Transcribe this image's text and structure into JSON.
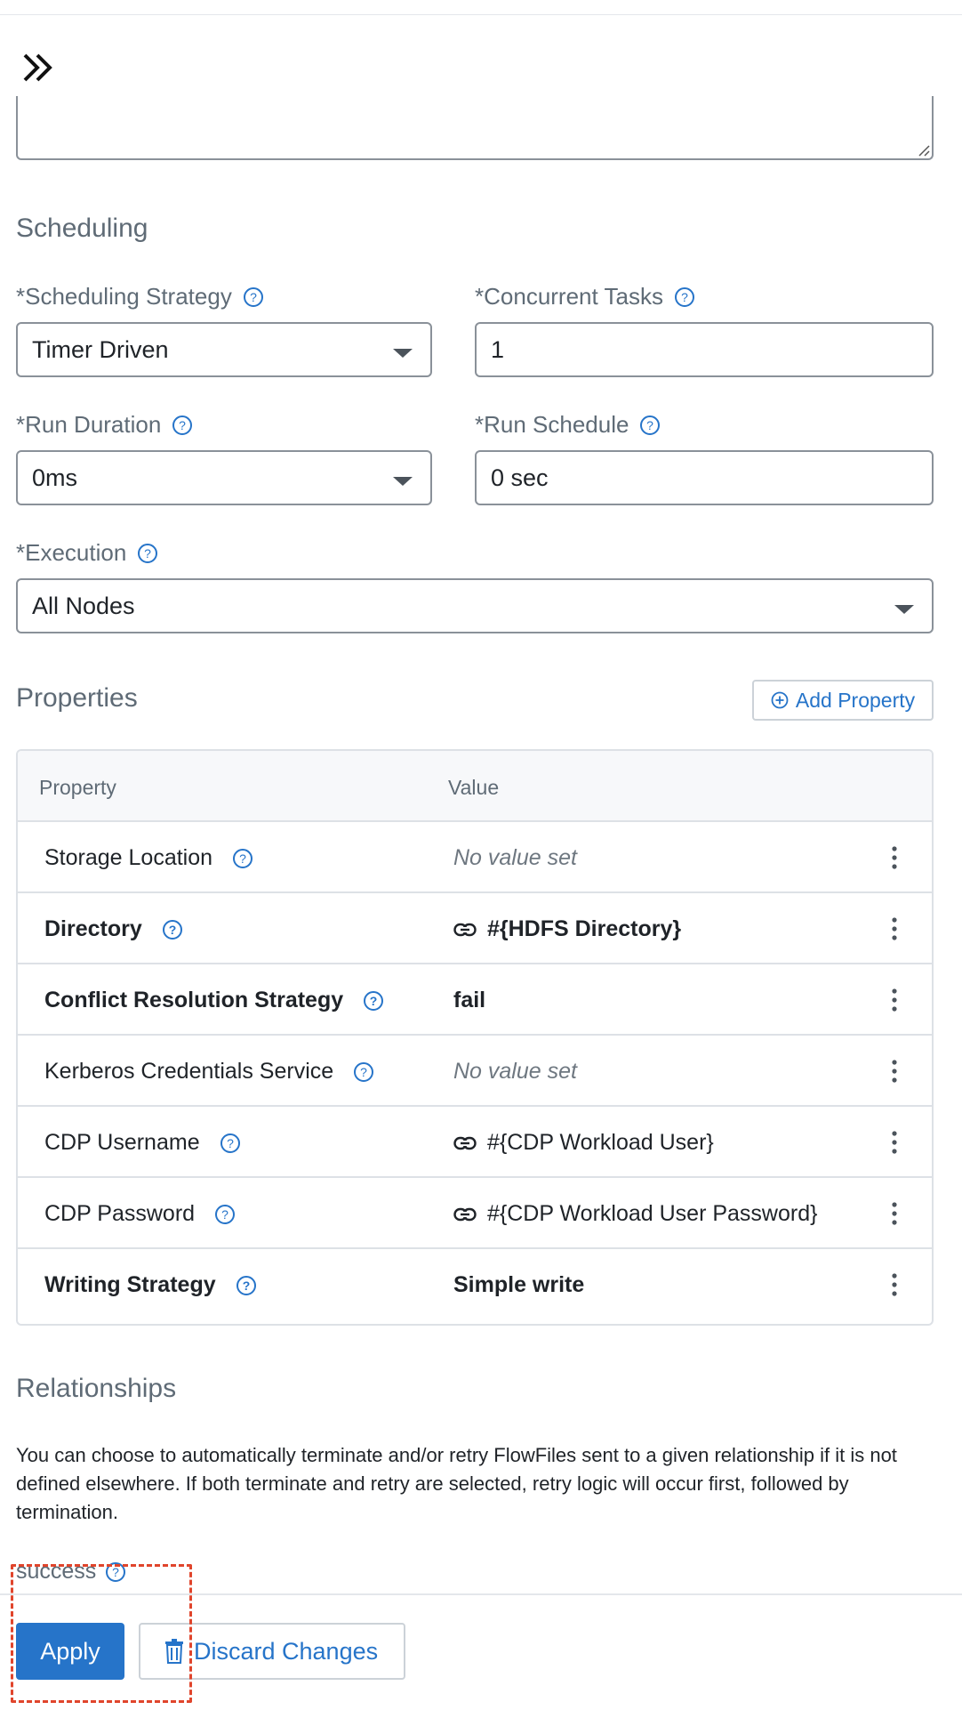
{
  "icons": {
    "expand": "double-chevron-right-icon",
    "help": "question-circle-icon",
    "add": "plus-circle-icon",
    "link": "link-icon",
    "more": "vertical-dots-icon",
    "trash": "trash-icon"
  },
  "colors": {
    "accent": "#2674c9",
    "annotation": "#e0452c",
    "muted_text": "#5f6b76"
  },
  "scheduling": {
    "section_title": "Scheduling",
    "strategy": {
      "label": "*Scheduling Strategy",
      "value": "Timer Driven"
    },
    "concurrent_tasks": {
      "label": "*Concurrent Tasks",
      "value": "1"
    },
    "run_duration": {
      "label": "*Run Duration",
      "value": "0ms"
    },
    "run_schedule": {
      "label": "*Run Schedule",
      "value": "0 sec"
    },
    "execution": {
      "label": "*Execution",
      "value": "All Nodes"
    }
  },
  "properties": {
    "section_title": "Properties",
    "add_button_label": "Add Property",
    "columns": [
      "Property",
      "Value"
    ],
    "rows": [
      {
        "name": "Storage Location",
        "value": "No value set",
        "required": false,
        "is_parameter": false,
        "empty": true
      },
      {
        "name": "Directory",
        "value": "#{HDFS Directory}",
        "required": true,
        "is_parameter": true,
        "empty": false
      },
      {
        "name": "Conflict Resolution Strategy",
        "value": "fail",
        "required": true,
        "is_parameter": false,
        "empty": false
      },
      {
        "name": "Kerberos Credentials Service",
        "value": "No value set",
        "required": false,
        "is_parameter": false,
        "empty": true
      },
      {
        "name": "CDP Username",
        "value": "#{CDP Workload User}",
        "required": false,
        "is_parameter": true,
        "empty": false
      },
      {
        "name": "CDP Password",
        "value": "#{CDP Workload User Password}",
        "required": false,
        "is_parameter": true,
        "empty": false
      },
      {
        "name": "Writing Strategy",
        "value": "Simple write",
        "required": true,
        "is_parameter": false,
        "empty": false
      }
    ]
  },
  "relationships": {
    "section_title": "Relationships",
    "description": "You can choose to automatically terminate and/or retry FlowFiles sent to a given relationship if it is not defined elsewhere. If both terminate and retry are selected, retry logic will occur first, followed by termination.",
    "items": [
      {
        "name": "success"
      }
    ]
  },
  "footer": {
    "apply_label": "Apply",
    "discard_label": "Discard Changes"
  }
}
